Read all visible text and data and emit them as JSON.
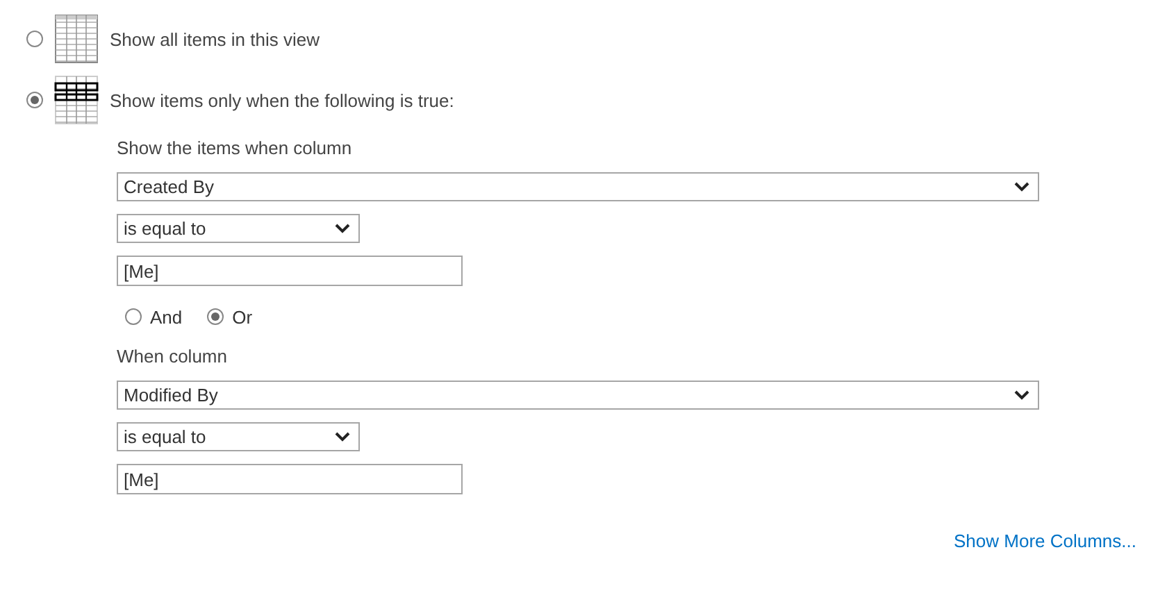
{
  "view_options": [
    {
      "kind": "all",
      "label": "Show all items in this view",
      "selected": false
    },
    {
      "kind": "filtered",
      "label": "Show items only when the following is true:",
      "selected": true
    }
  ],
  "filters": [
    {
      "label": "Show the items when column",
      "column": "Created By",
      "operator": "is equal to",
      "value": "[Me]"
    },
    {
      "label": "When column",
      "column": "Modified By",
      "operator": "is equal to",
      "value": "[Me]"
    }
  ],
  "connector": [
    {
      "label": "And",
      "selected": false
    },
    {
      "label": "Or",
      "selected": true
    }
  ],
  "link": "Show More Columns..."
}
